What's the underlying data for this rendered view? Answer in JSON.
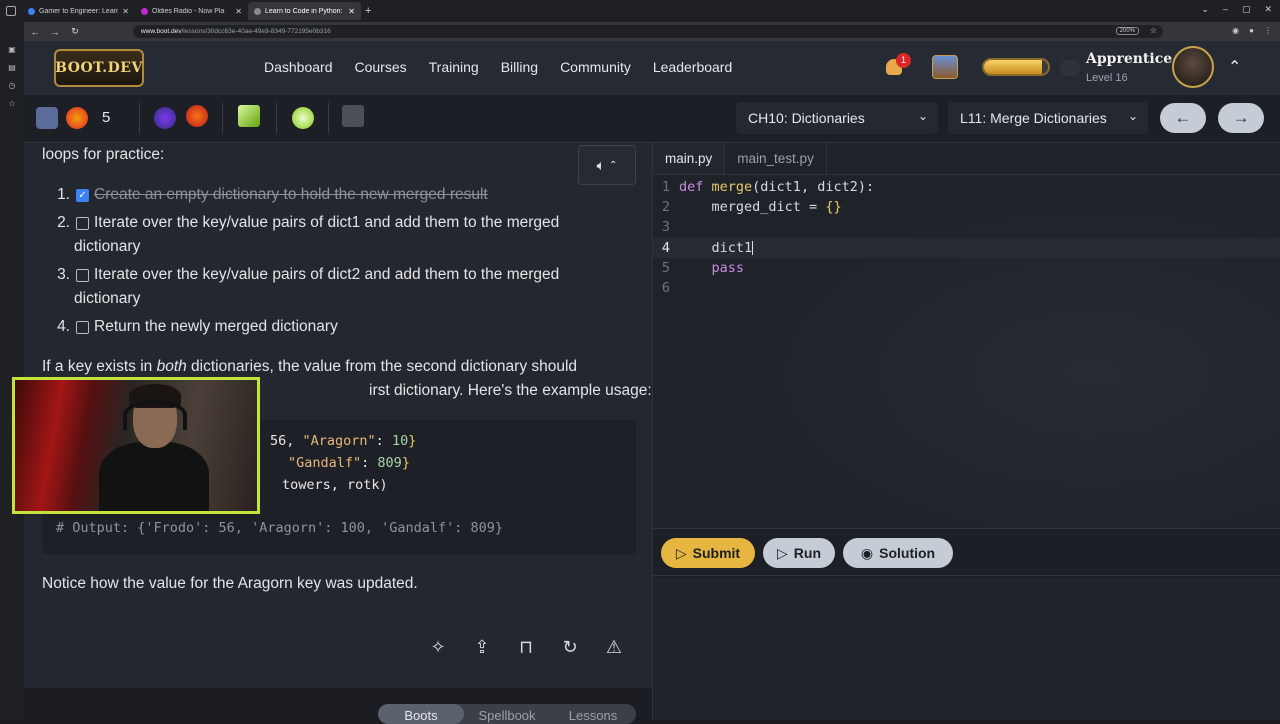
{
  "browser": {
    "tabs": [
      {
        "title": "Gamer to Engineer: Learni"
      },
      {
        "title": "Oldies Radio - Now Pla"
      },
      {
        "title": "Learn to Code in Python: l"
      }
    ],
    "url_host": "www.boot.dev",
    "url_path": "/lessons/30dcc63e-40ae-49e9-8349-772195e0b316",
    "zoom": "200%"
  },
  "header": {
    "logo": "BOOT.DEV",
    "nav": [
      "Dashboard",
      "Courses",
      "Training",
      "Billing",
      "Community",
      "Leaderboard"
    ],
    "notification_count": "1",
    "xp_fill_percent": 90,
    "rank": "Apprentice",
    "level": "Level 16"
  },
  "toolbar": {
    "streak": "5",
    "chapter": "CH10: Dictionaries",
    "lesson": "L11: Merge Dictionaries",
    "prev": "←",
    "next": "→"
  },
  "lesson": {
    "intro": "loops for practice:",
    "steps": [
      {
        "num": "1.",
        "text": "Create an empty dictionary to hold the new merged result",
        "done": true
      },
      {
        "num": "2.",
        "text": "Iterate over the key/value pairs of dict1 and add them to the merged",
        "cont": "dictionary"
      },
      {
        "num": "3.",
        "text": "Iterate over the key/value pairs of dict2 and add them to the merged",
        "cont": "dictionary"
      },
      {
        "num": "4.",
        "text": "Return the newly merged dictionary"
      }
    ],
    "para_a": "If a key exists in ",
    "para_em": "both",
    "para_b": " dictionaries, the value from the second dictionary should",
    "para2": "irst dictionary. Here's the example usage:",
    "code": {
      "l1a": "56, ",
      "l1s": "\"Aragorn\"",
      "l1b": ": ",
      "l1n": "10",
      "l1c": "}",
      "l2s": "\"Gandalf\"",
      "l2b": ": ",
      "l2n": "809",
      "l2c": "}",
      "l3": "towers, rotk)",
      "output": "# Output: {'Frodo': 56, 'Aragorn': 100, 'Gandalf': 809}"
    },
    "notice": "Notice how the value for the Aragorn key was updated."
  },
  "bottom_tabs": [
    "Boots",
    "Spellbook",
    "Lessons"
  ],
  "editor": {
    "files": [
      "main.py",
      "main_test.py"
    ],
    "lines": [
      "1",
      "2",
      "3",
      "4",
      "5",
      "6"
    ],
    "code": {
      "def": "def",
      "fn": "merge",
      "sig": "(dict1, dict2):",
      "l2": "    merged_dict = ",
      "l2b": "{}",
      "l4": "    dict1",
      "l5": "    pass"
    }
  },
  "actions": {
    "submit": "Submit",
    "run": "Run",
    "solution": "Solution"
  }
}
